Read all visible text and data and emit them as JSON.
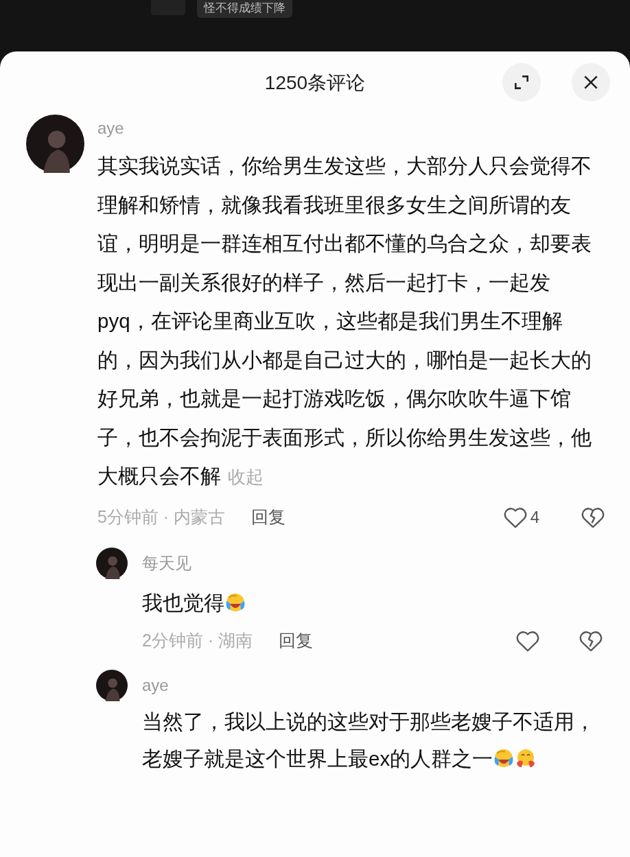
{
  "background_video": {
    "caption": "怪不得成绩下降"
  },
  "panel": {
    "title": "1250条评论"
  },
  "comments": [
    {
      "author": "aye",
      "text": "其实我说实话，你给男生发这些，大部分人只会觉得不理解和矫情，就像我看我班里很多女生之间所谓的友谊，明明是一群连相互付出都不懂的乌合之众，却要表现出一副关系很好的样子，然后一起打卡，一起发pyq，在评论里商业互吹，这些都是我们男生不理解的，因为我们从小都是自己过大的，哪怕是一起长大的好兄弟，也就是一起打游戏吃饭，偶尔吹吹牛逼下馆子，也不会拘泥于表面形式，所以你给男生发这些，他大概只会不解",
      "collapse_link": "收起",
      "time_location": "5分钟前 · 内蒙古",
      "reply_label": "回复",
      "like_count": "4",
      "liked": false,
      "disliked": false,
      "replies": [
        {
          "author": "每天见",
          "text": "我也觉得",
          "emojis": [
            {
              "kind": "laugh-cry"
            }
          ],
          "time_location": "2分钟前 · 湖南",
          "reply_label": "回复",
          "liked": false,
          "disliked": false
        },
        {
          "author": "aye",
          "text": "当然了，我以上说的这些对于那些老嫂子不适用，老嫂子就是这个世界上最ex的人群之一",
          "emojis": [
            {
              "kind": "laugh-cry"
            },
            {
              "kind": "hug"
            }
          ]
        }
      ]
    }
  ]
}
